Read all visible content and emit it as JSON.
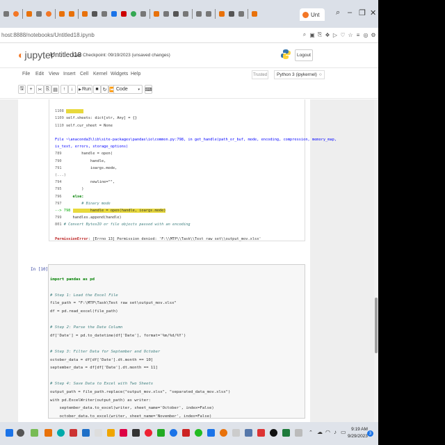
{
  "browser": {
    "active_tab_label": "Unt",
    "url": "host:8888/notebooks/Untitled18.ipynb"
  },
  "jupyter": {
    "logo_text": "jupyter",
    "notebook_name": "Untitled18",
    "checkpoint": "Last Checkpoint: 09/19/2023   (unsaved changes)",
    "logout_label": "Logout",
    "menu": [
      "File",
      "Edit",
      "View",
      "Insert",
      "Cell",
      "Kernel",
      "Widgets",
      "Help"
    ],
    "trusted_label": "Trusted",
    "kernel_label": "Python 3 (ipykernel)",
    "toolbar": {
      "run_label": "Run",
      "cell_type": "Code"
    }
  },
  "error_output": {
    "lines": [
      {
        "ln": "1108",
        "code": "        "
      },
      {
        "ln": "1109",
        "code": "self.sheets: dict[str, Any] = {}"
      },
      {
        "ln": "1110",
        "code": "self.cur_sheet = None"
      },
      {
        "ln": "",
        "code": ""
      },
      {
        "ln": "",
        "code": "File ~\\anaconda3\\lib\\site-packages\\pandas\\io\\common.py:798, in get_handle(path_or_buf, mode, encoding, compression, memory_map,"
      },
      {
        "ln": "",
        "code": "is_text, errors, storage_options)"
      },
      {
        "ln": "789",
        "code": "        handle = open("
      },
      {
        "ln": "790",
        "code": "            handle,"
      },
      {
        "ln": "791",
        "code": "            ioargs.mode,"
      },
      {
        "ln": "(...)",
        "code": ""
      },
      {
        "ln": "794",
        "code": "            newline=\"\","
      },
      {
        "ln": "795",
        "code": "        )"
      },
      {
        "ln": "796",
        "code": "    else:"
      },
      {
        "ln": "797",
        "code": "        # Binary mode"
      },
      {
        "ln": "--> 798",
        "code": "        handle = open(handle, ioargs.mode)"
      },
      {
        "ln": "799",
        "code": "    handles.append(handle)"
      },
      {
        "ln": "801",
        "code": "# Convert BytesIO or file objects passed with an encoding"
      }
    ],
    "error_name": "PermissionError",
    "error_message": ": [Errno 13] Permission denied: 'F:\\\\MTP\\\\Task\\\\Test raw set\\\\output_mov.xlsx'"
  },
  "input_cell": {
    "prompt": "In [10]:",
    "lines": [
      "import pandas as pd",
      "",
      "# Step 1: Load the Excel File",
      "file_path = \"F:\\MTP\\Task\\Test raw set\\output_mov.xlsx\"",
      "df = pd.read_excel(file_path)",
      "",
      "# Step 2: Parse the Date Column",
      "df['Date'] = pd.to_datetime(df['Date'], format='%m/%d/%Y')",
      "",
      "# Step 3: Filter Data for September and October",
      "october_data = df[df['Date'].dt.month == 10]",
      "september_data = df[df['Date'].dt.month == 11]",
      "",
      "# Step 4: Save Data to Excel with Two Sheets",
      "output_path = file_path.replace(\"output_mov.xlsx\", \"separated_data_mov.xlsx\")",
      "with pd.ExcelWriter(output_path) as writer:",
      "    september_data.to_excel(writer, sheet_name='October', index=False)",
      "    october_data.to_excel(writer, sheet_name='November', index=False)"
    ]
  },
  "taskbar": {
    "time": "9:19 AM",
    "date": "9/29/2023",
    "notification_count": "3"
  },
  "colors": {
    "jupyter_orange": "#f37726",
    "prompt_blue": "#303f9f",
    "highlight_yellow": "#e8d93c"
  }
}
